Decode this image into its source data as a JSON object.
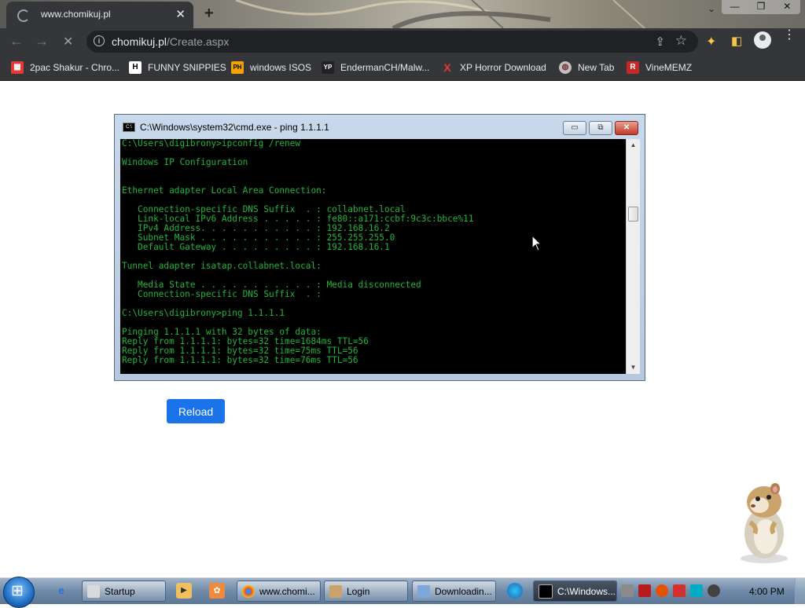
{
  "browser": {
    "tab_title": "www.chomikuj.pl",
    "tab_close": "✕",
    "new_tab": "+",
    "window_controls": {
      "minimize": "—",
      "restore": "❐",
      "close": "✕"
    },
    "url_domain": "chomikuj.pl",
    "url_path": "/Create.aspx",
    "nav_back": "←",
    "nav_forward": "→",
    "nav_stop": "✕"
  },
  "bookmarks": [
    {
      "label": "2pac Shakur - Chro...",
      "icon": "calendar-icon",
      "badge": "▦",
      "color": "#e53935"
    },
    {
      "label": "FUNNY SNIPPIES",
      "icon": "h-logo-icon",
      "badge": "H",
      "color": "#ffffff"
    },
    {
      "label": "windows ISOS",
      "icon": "ph-logo-icon",
      "badge": "PH",
      "color": "#f5a300"
    },
    {
      "label": "EndermanCH/Malw...",
      "icon": "yp-logo-icon",
      "badge": "YP",
      "color": "#222222"
    },
    {
      "label": "XP Horror Download",
      "icon": "x-logo-icon",
      "badge": "X",
      "color": "#e53935"
    },
    {
      "label": "New Tab",
      "icon": "globe-icon",
      "badge": "◍",
      "color": "#c0c0c0"
    },
    {
      "label": "VineMEMZ",
      "icon": "r-logo-icon",
      "badge": "R",
      "color": "#c62828"
    }
  ],
  "cmd": {
    "title": "C:\\Windows\\system32\\cmd.exe - ping  1.1.1.1",
    "lines": [
      "C:\\Users\\digibrony>ipconfig /renew",
      "",
      "Windows IP Configuration",
      "",
      "",
      "Ethernet adapter Local Area Connection:",
      "",
      "   Connection-specific DNS Suffix  . : collabnet.local",
      "   Link-local IPv6 Address . . . . . : fe80::a171:ccbf:9c3c:bbce%11",
      "   IPv4 Address. . . . . . . . . . . : 192.168.16.2",
      "   Subnet Mask . . . . . . . . . . . : 255.255.255.0",
      "   Default Gateway . . . . . . . . . : 192.168.16.1",
      "",
      "Tunnel adapter isatap.collabnet.local:",
      "",
      "   Media State . . . . . . . . . . . : Media disconnected",
      "   Connection-specific DNS Suffix  . :",
      "",
      "C:\\Users\\digibrony>ping 1.1.1.1",
      "",
      "Pinging 1.1.1.1 with 32 bytes of data:",
      "Reply from 1.1.1.1: bytes=32 time=1684ms TTL=56",
      "Reply from 1.1.1.1: bytes=32 time=75ms TTL=56",
      "Reply from 1.1.1.1: bytes=32 time=76ms TTL=56"
    ]
  },
  "page": {
    "reload_label": "Reload"
  },
  "taskbar": {
    "tasks": [
      {
        "label": "Startup",
        "name": "task-startup",
        "color": "#d9d9d9"
      },
      {
        "label": "www.chomi...",
        "name": "task-chrome",
        "color": "#4285f4"
      },
      {
        "label": "Login",
        "name": "task-login",
        "color": "#c9a36b"
      },
      {
        "label": "Downloadin...",
        "name": "task-downloading",
        "color": "#7da7d9"
      },
      {
        "label": "C:\\Windows...",
        "name": "task-cmd",
        "color": "#000000"
      }
    ],
    "clock": "4:00 PM"
  }
}
